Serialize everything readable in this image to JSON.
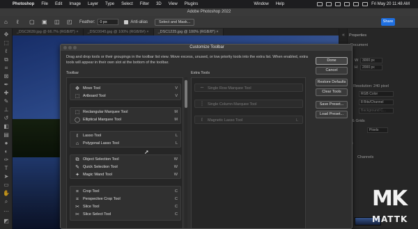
{
  "menubar": {
    "app": "Photoshop",
    "items": [
      "File",
      "Edit",
      "Image",
      "Layer",
      "Type",
      "Select",
      "Filter",
      "3D",
      "View",
      "Plugins",
      "Window",
      "Help"
    ],
    "clock": "Fri May 20  11:48 AM"
  },
  "window": {
    "title": "Adobe Photoshop 2022"
  },
  "options": {
    "feather_label": "Feather:",
    "feather_value": "0 px",
    "antialias_label": "Anti-alias",
    "select_mask": "Select and Mask...",
    "share": "Share"
  },
  "doc_tabs": [
    "_DSC3639.jpg @ 66.7% (RGB/8*) ×",
    "_DSC0045.jpg @ 100% (RGB/8#) ×",
    "_DSC1225.jpg @ 100% (RGB/8*) ×"
  ],
  "properties": {
    "title": "Properties",
    "document": "Document",
    "w_label": "W",
    "w_value": "3000 px",
    "h_label": "H",
    "h_value": "2000 px",
    "resolution": "Resolution: 240 pixel",
    "mode": "RGB Color",
    "depth": "8 Bits/Channel",
    "background": "Background C...",
    "grids": "s & Grids",
    "pixels": "Pixels",
    "channels": "Channels",
    "es": "es"
  },
  "dialog": {
    "title": "Customize Toolbar",
    "description": "Drag and drop tools or their groupings in the toolbar list view. Move excess, unused, or low priority tools into the extra list. When enabled, extra tools will appear in their own slot at the bottom of the toolbar.",
    "toolbar_label": "Toolbar",
    "extra_label": "Extra Tools",
    "groups": [
      {
        "tools": [
          {
            "icon": "✥",
            "name": "Move Tool",
            "key": "V"
          },
          {
            "icon": "⬚",
            "name": "Artboard Tool",
            "key": "V"
          }
        ]
      },
      {
        "tools": [
          {
            "icon": "⬚",
            "name": "Rectangular Marquee Tool",
            "key": "M"
          },
          {
            "icon": "◯",
            "name": "Elliptical Marquee Tool",
            "key": "M"
          }
        ]
      },
      {
        "tools": [
          {
            "icon": "ℓ",
            "name": "Lasso Tool",
            "key": "L"
          },
          {
            "icon": "⌂",
            "name": "Polygonal Lasso Tool",
            "key": "L"
          }
        ]
      },
      {
        "tools": [
          {
            "icon": "⧉",
            "name": "Object Selection Tool",
            "key": "W"
          },
          {
            "icon": "✎",
            "name": "Quick Selection Tool",
            "key": "W"
          },
          {
            "icon": "✦",
            "name": "Magic Wand Tool",
            "key": "W"
          }
        ]
      },
      {
        "tools": [
          {
            "icon": "⌗",
            "name": "Crop Tool",
            "key": "C"
          },
          {
            "icon": "⌗",
            "name": "Perspective Crop Tool",
            "key": "C"
          },
          {
            "icon": "✂",
            "name": "Slice Tool",
            "key": "C"
          },
          {
            "icon": "✂",
            "name": "Slice Select Tool",
            "key": "C"
          }
        ]
      }
    ],
    "extra_tools": [
      {
        "icon": "┅",
        "name": "Single Row Marquee Tool",
        "key": ""
      },
      {
        "icon": "┆",
        "name": "Single Column Marquee Tool",
        "key": ""
      },
      {
        "icon": "ℓ",
        "name": "Magnetic Lasso Tool",
        "key": "L"
      }
    ],
    "buttons": {
      "done": "Done",
      "cancel": "Cancel",
      "restore": "Restore Defaults",
      "clear": "Clear Tools",
      "save": "Save Preset...",
      "load": "Load Preset..."
    }
  },
  "watermark": {
    "logo": "MK",
    "name": "MATTK"
  }
}
